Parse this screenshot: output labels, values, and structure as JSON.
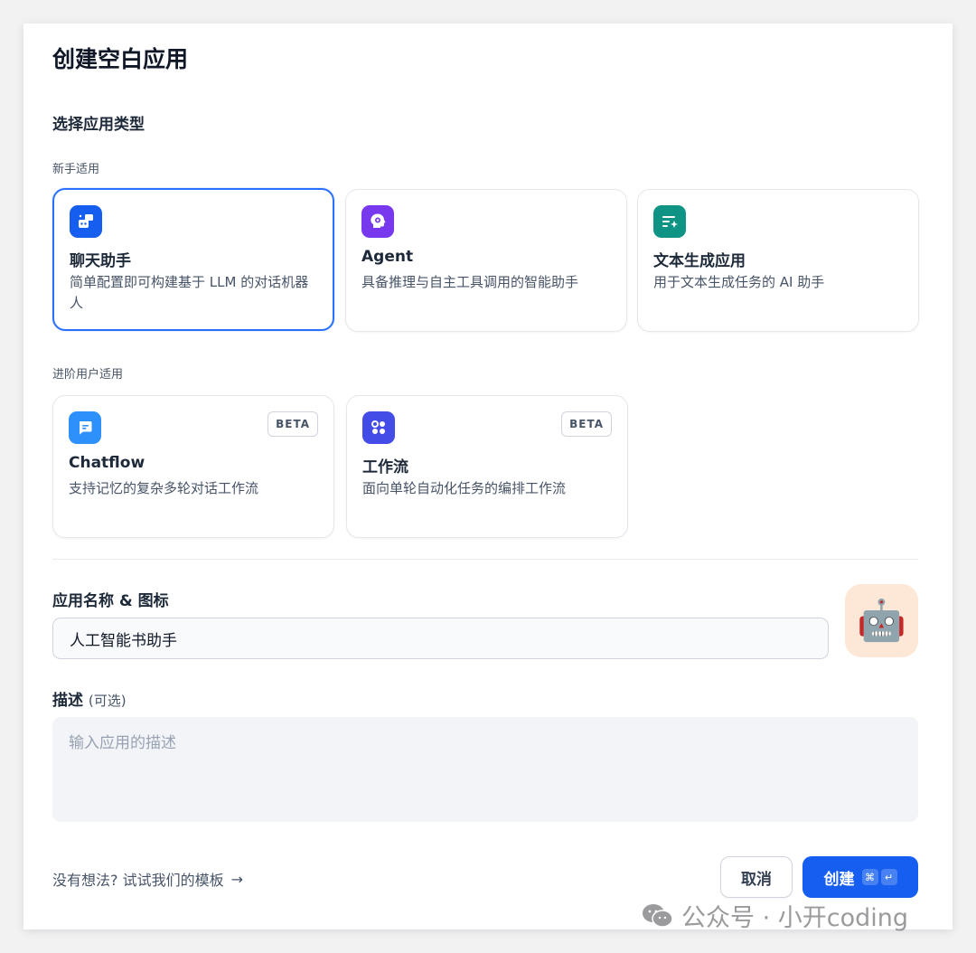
{
  "dialog": {
    "title": "创建空白应用",
    "section_title": "选择应用类型"
  },
  "beginner_group": {
    "label": "新手适用",
    "cards": [
      {
        "name": "聊天助手",
        "desc": "简单配置即可构建基于 LLM 的对话机器人",
        "icon": "chatbot-icon",
        "color": "#155eef",
        "selected": true
      },
      {
        "name": "Agent",
        "desc": "具备推理与自主工具调用的智能助手",
        "icon": "agent-brain-icon",
        "color": "#7839ee",
        "selected": false
      },
      {
        "name": "文本生成应用",
        "desc": "用于文本生成任务的 AI 助手",
        "icon": "text-generation-icon",
        "color": "#0e9384",
        "selected": false
      }
    ]
  },
  "advanced_group": {
    "label": "进阶用户适用",
    "cards": [
      {
        "name": "Chatflow",
        "desc": "支持记忆的复杂多轮对话工作流",
        "icon": "chatflow-icon",
        "color": "#2e90fa",
        "badge": "BETA"
      },
      {
        "name": "工作流",
        "desc": "面向单轮自动化任务的编排工作流",
        "icon": "workflow-icon",
        "color": "#444ce7",
        "badge": "BETA"
      }
    ]
  },
  "name_field": {
    "label": "应用名称 & 图标",
    "value": "人工智能书助手",
    "avatar_icon": "robot-emoji-icon",
    "avatar_glyph": "🤖",
    "avatar_bg": "#fde8d7"
  },
  "description_field": {
    "label": "描述",
    "optional": "(可选)",
    "placeholder": "输入应用的描述"
  },
  "footer": {
    "template_link": "没有想法? 试试我们的模板",
    "template_arrow": "→",
    "cancel_label": "取消",
    "create_label": "创建",
    "shortcut_keys": [
      "⌘",
      "↵"
    ]
  },
  "watermark": {
    "text": "公众号 · 小开coding",
    "icon": "wechat-icon"
  },
  "colors": {
    "primary": "#155eef",
    "selected_border": "#2970ff"
  }
}
